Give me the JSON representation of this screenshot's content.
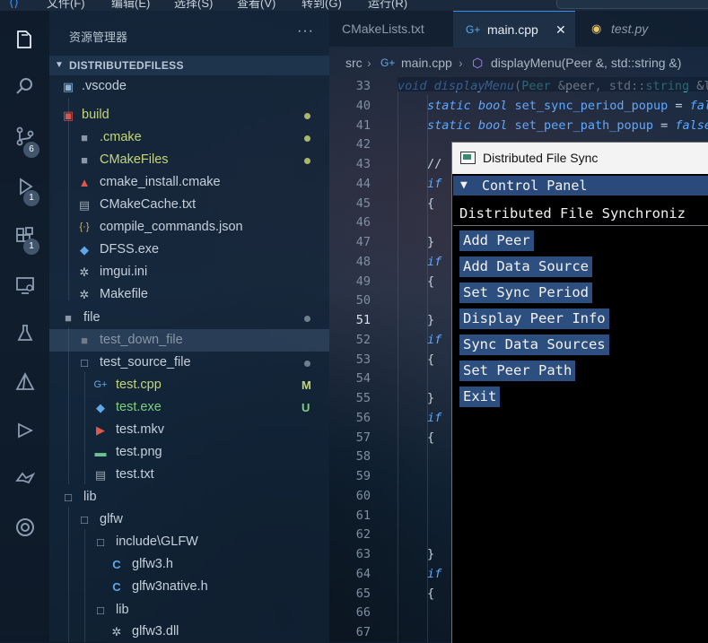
{
  "menubar": {
    "items": [
      "文件(F)",
      "编辑(E)",
      "选择(S)",
      "查看(V)",
      "转到(G)",
      "运行(R)"
    ]
  },
  "activity_bar": {
    "icons": [
      "explorer-icon",
      "search-icon",
      "source-control-icon",
      "run-debug-icon",
      "extensions-icon",
      "remote-explorer-icon",
      "testing-icon",
      "cmake-icon",
      "docker-icon",
      "github-icon"
    ],
    "badges": {
      "source_control": "6",
      "run_debug": "1",
      "extensions": "1"
    }
  },
  "sidebar": {
    "title": "资源管理器",
    "more": "···",
    "root": "DISTRIBUTEDFILESS",
    "items": [
      {
        "name": ".vscode",
        "icon": "vscode-folder-icon"
      },
      {
        "name": "build",
        "icon": "folder-icon",
        "marker": "dot"
      },
      {
        "name": ".cmake",
        "icon": "folder-icon",
        "marker": "dot"
      },
      {
        "name": "CMakeFiles",
        "icon": "folder-icon",
        "marker": "dot"
      },
      {
        "name": "cmake_install.cmake",
        "icon": "cmake-file-icon"
      },
      {
        "name": "CMakeCache.txt",
        "icon": "text-file-icon"
      },
      {
        "name": "compile_commands.json",
        "icon": "json-file-icon"
      },
      {
        "name": "DFSS.exe",
        "icon": "exe-file-icon"
      },
      {
        "name": "imgui.ini",
        "icon": "settings-file-icon"
      },
      {
        "name": "Makefile",
        "icon": "settings-file-icon"
      },
      {
        "name": "file",
        "icon": "folder-icon",
        "marker": "dot"
      },
      {
        "name": "test_down_file",
        "icon": "folder-icon"
      },
      {
        "name": "test_source_file",
        "icon": "folder-icon",
        "marker": "dot"
      },
      {
        "name": "test.cpp",
        "icon": "cpp-file-icon",
        "status": "M"
      },
      {
        "name": "test.exe",
        "icon": "exe-file-icon",
        "status": "U"
      },
      {
        "name": "test.mkv",
        "icon": "video-file-icon"
      },
      {
        "name": "test.png",
        "icon": "image-file-icon"
      },
      {
        "name": "test.txt",
        "icon": "text-file-icon"
      },
      {
        "name": "lib",
        "icon": "folder-icon"
      },
      {
        "name": "glfw",
        "icon": "folder-icon"
      },
      {
        "name": "include\\GLFW",
        "icon": "folder-icon"
      },
      {
        "name": "glfw3.h",
        "icon": "c-header-icon"
      },
      {
        "name": "glfw3native.h",
        "icon": "c-header-icon"
      },
      {
        "name": "lib",
        "icon": "folder-icon"
      },
      {
        "name": "glfw3.dll",
        "icon": "dll-file-icon"
      }
    ]
  },
  "tabs": [
    {
      "label": "CMakeLists.txt"
    },
    {
      "label": "main.cpp",
      "active": true,
      "close": "✕"
    },
    {
      "label": "test.py"
    }
  ],
  "breadcrumb": {
    "parts": [
      "src",
      "main.cpp",
      "displayMenu(Peer &, std::string &)"
    ]
  },
  "editor": {
    "line_numbers": [
      "33",
      "40",
      "41",
      "42",
      "43",
      "44",
      "45",
      "46",
      "47",
      "48",
      "49",
      "50",
      "51",
      "52",
      "53",
      "54",
      "55",
      "56",
      "57",
      "58",
      "59",
      "60",
      "61",
      "62",
      "63",
      "64",
      "65",
      "66",
      "67"
    ],
    "current_line": "51",
    "code_lines": [
      {
        "tokens": [
          [
            "void ",
            "kw"
          ],
          [
            "displayMenu",
            "fn"
          ],
          [
            "(",
            "pn"
          ],
          [
            "Peer ",
            "tp"
          ],
          [
            "&",
            "pn"
          ],
          [
            "peer",
            "id"
          ],
          [
            ", std::",
            "pn"
          ],
          [
            "string ",
            "tp"
          ],
          [
            "&lo",
            "id"
          ]
        ]
      },
      {
        "tokens": [
          [
            "static ",
            "kw"
          ],
          [
            "bool ",
            "kw"
          ],
          [
            "set_sync_period_popup ",
            "vr"
          ],
          [
            "= ",
            "pn"
          ],
          [
            "fals",
            "kw"
          ]
        ]
      },
      {
        "tokens": [
          [
            "static ",
            "kw"
          ],
          [
            "bool ",
            "kw"
          ],
          [
            "set_peer_path_popup ",
            "vr"
          ],
          [
            "= ",
            "pn"
          ],
          [
            "false;",
            "kw"
          ]
        ]
      },
      {
        "tokens": []
      },
      {
        "tokens": [
          [
            "// ",
            "pn"
          ]
        ]
      },
      {
        "tokens": [
          [
            "if",
            "kw"
          ]
        ]
      },
      {
        "tokens": [
          [
            "{",
            "pn"
          ]
        ]
      },
      {
        "tokens": []
      },
      {
        "tokens": [
          [
            "}",
            "pn"
          ]
        ]
      },
      {
        "tokens": [
          [
            "if",
            "kw"
          ]
        ]
      },
      {
        "tokens": [
          [
            "{",
            "pn"
          ]
        ]
      },
      {
        "tokens": []
      },
      {
        "tokens": [
          [
            "}",
            "pn"
          ]
        ]
      },
      {
        "tokens": [
          [
            "if",
            "kw"
          ]
        ]
      },
      {
        "tokens": [
          [
            "{",
            "pn"
          ]
        ]
      },
      {
        "tokens": []
      },
      {
        "tokens": [
          [
            "}",
            "pn"
          ]
        ]
      },
      {
        "tokens": [
          [
            "if",
            "kw"
          ]
        ]
      },
      {
        "tokens": [
          [
            "{",
            "pn"
          ]
        ]
      },
      {
        "tokens": []
      },
      {
        "tokens": []
      },
      {
        "tokens": []
      },
      {
        "tokens": []
      },
      {
        "tokens": []
      },
      {
        "tokens": [
          [
            "}",
            "pn"
          ]
        ]
      },
      {
        "tokens": [
          [
            "if",
            "kw"
          ]
        ]
      },
      {
        "tokens": [
          [
            "{",
            "pn"
          ]
        ]
      },
      {
        "tokens": []
      },
      {
        "tokens": []
      }
    ]
  },
  "imgui_window": {
    "title": "Distributed File Sync",
    "header": "Control Panel",
    "header_arrow": "▼",
    "text": "Distributed File Synchroniz",
    "buttons": [
      "Add Peer",
      "Add Data Source",
      "Set Sync Period",
      "Display Peer Info",
      "Sync Data Sources",
      "Set Peer Path",
      "Exit"
    ]
  },
  "colors": {
    "accent": "#3b8eea",
    "modified": "#c3d67a",
    "untracked": "#7fd07f",
    "imgui_button": "#2d4f80",
    "imgui_header": "#294a7a"
  }
}
